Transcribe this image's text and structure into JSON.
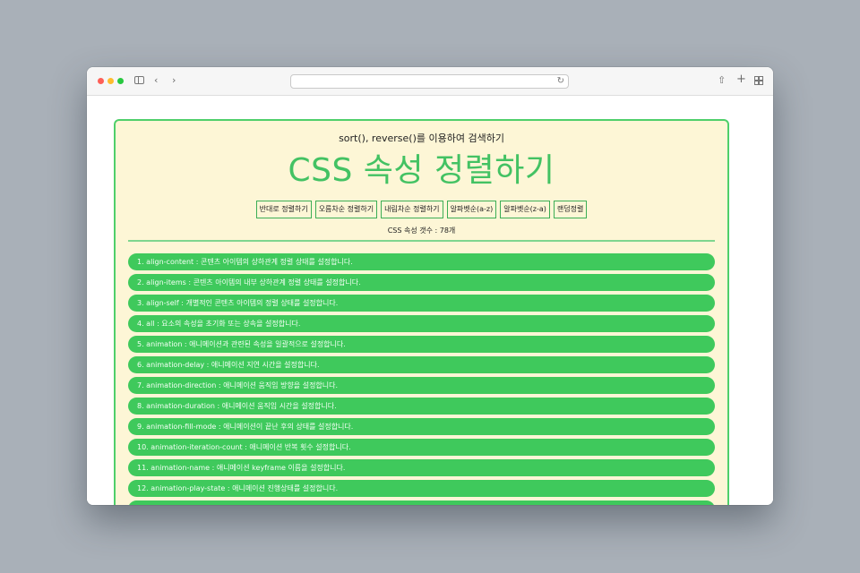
{
  "browser": {
    "url": ""
  },
  "page": {
    "subtitle": "sort(), reverse()를 이용하여 검색하기",
    "title": "CSS 속성 정렬하기",
    "buttons": [
      "반대로 정렬하기",
      "오름차순 정렬하기",
      "내림차순 정렬하기",
      "알파벳순(a-z)",
      "알파벳순(z-a)",
      "랜덤정렬"
    ],
    "count_text": "CSS 속성 갯수 : 78개",
    "items": [
      "1. align-content : 콘텐츠 아이템의 상하관계 정렬 상태를 설정합니다.",
      "2. align-items : 콘텐츠 아이템의 내부 상하관계 정렬 상태를 설정합니다.",
      "3. align-self : 개별적인 콘텐츠 아이템의 정렬 상태를 설정합니다.",
      "4. all : 요소의 속성을 초기화 또는 상속을 설정합니다.",
      "5. animation : 애니메이션과 관련된 속성을 일괄적으로 설정합니다.",
      "6. animation-delay : 애니메이션 지연 시간을 설정합니다.",
      "7. animation-direction : 애니메이션 움직임 방향을 설정합니다.",
      "8. animation-duration : 애니메이션 움직임 시간을 설정합니다.",
      "9. animation-fill-mode : 애니메이션이 끝난 후의 상태를 설정합니다.",
      "10. animation-iteration-count : 애니메이션 반복 횟수 설정합니다.",
      "11. animation-name : 애니메이션 keyframe 이름을 설정합니다.",
      "12. animation-play-state : 애니메이션 진행상태를 설정합니다.",
      ""
    ]
  },
  "colors": {
    "accent": "#43c263",
    "panel_bg": "#fdf6d6",
    "item_bg": "#3fc95c"
  }
}
